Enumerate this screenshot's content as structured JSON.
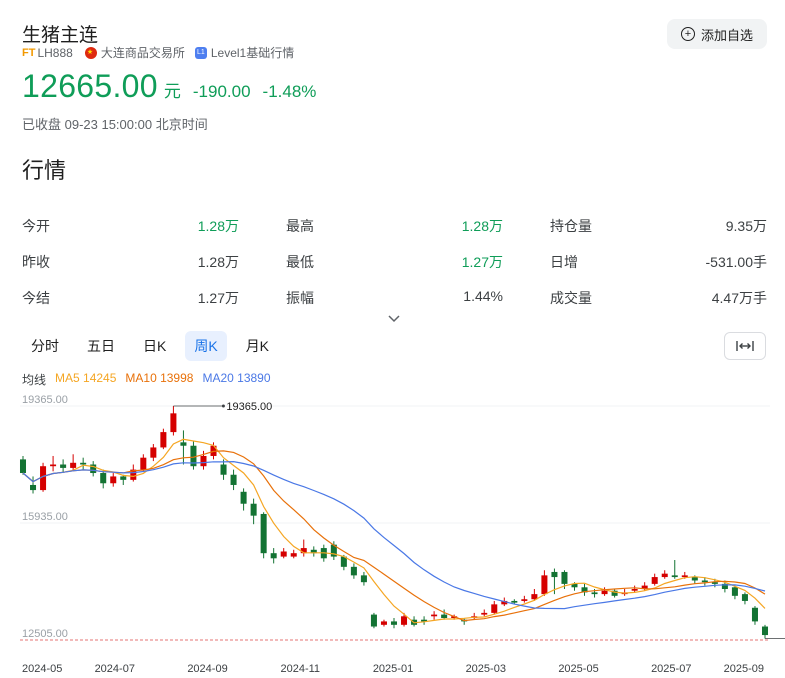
{
  "header": {
    "title": "生猪主连",
    "ft_badge": "FT",
    "code": "LH888",
    "exchange": "大连商品交易所",
    "level_badge": "L1",
    "level_text": "Level1基础行情",
    "add_button": "添加自选"
  },
  "quote": {
    "price": "12665.00",
    "unit": "元",
    "change": "-190.00",
    "change_pct": "-1.48%",
    "status": "已收盘 09-23 15:00:00 北京时间"
  },
  "section_title": "行情",
  "stats": [
    [
      {
        "label": "今开",
        "value": "1.28万",
        "color": "green"
      },
      {
        "label": "最高",
        "value": "1.28万",
        "color": "green"
      },
      {
        "label": "持仓量",
        "value": "9.35万",
        "color": "plain"
      }
    ],
    [
      {
        "label": "昨收",
        "value": "1.28万",
        "color": "plain"
      },
      {
        "label": "最低",
        "value": "1.27万",
        "color": "green"
      },
      {
        "label": "日增",
        "value": "-531.00手",
        "color": "plain"
      }
    ],
    [
      {
        "label": "今结",
        "value": "1.27万",
        "color": "plain"
      },
      {
        "label": "振幅",
        "value": "1.44%",
        "color": "plain"
      },
      {
        "label": "成交量",
        "value": "4.47万手",
        "color": "plain"
      }
    ]
  ],
  "tabs": [
    {
      "label": "分时",
      "active": false
    },
    {
      "label": "五日",
      "active": false
    },
    {
      "label": "日K",
      "active": false
    },
    {
      "label": "周K",
      "active": true
    },
    {
      "label": "月K",
      "active": false
    }
  ],
  "ma": {
    "label": "均线",
    "ma5": "MA5 14245",
    "ma10": "MA10 13998",
    "ma20": "MA20 13890"
  },
  "colors": {
    "up": "#d50000",
    "down": "#137333",
    "ma5": "#f5a623",
    "ma10": "#e8710a",
    "ma20": "#4a78e6",
    "green_text": "#0f9d58"
  },
  "chart_data": {
    "type": "candlestick",
    "y_labels": [
      "19365.00",
      "15935.00",
      "12505.00"
    ],
    "ylim": [
      12505,
      19365
    ],
    "x_labels": [
      "2024-05",
      "2024-07",
      "2024-09",
      "2024-11",
      "2025-01",
      "2025-03",
      "2025-05",
      "2025-07",
      "2025-09"
    ],
    "max_annotation": "19365.00",
    "min_annotation": "12505.00",
    "candles": [
      [
        17800,
        17400,
        17900,
        17350
      ],
      [
        17050,
        16900,
        17300,
        16800
      ],
      [
        16900,
        17600,
        17700,
        16850
      ],
      [
        17600,
        17650,
        17900,
        17450
      ],
      [
        17650,
        17550,
        17800,
        17400
      ],
      [
        17550,
        17700,
        17950,
        17450
      ],
      [
        17700,
        17650,
        17850,
        17500
      ],
      [
        17650,
        17400,
        17750,
        17300
      ],
      [
        17400,
        17100,
        17500,
        16950
      ],
      [
        17100,
        17300,
        17400,
        17000
      ],
      [
        17300,
        17200,
        17350,
        17050
      ],
      [
        17200,
        17500,
        17650,
        17150
      ],
      [
        17500,
        17850,
        17950,
        17450
      ],
      [
        17850,
        18150,
        18250,
        17750
      ],
      [
        18150,
        18600,
        18700,
        18100
      ],
      [
        18600,
        19150,
        19365,
        18500
      ],
      [
        18300,
        18200,
        18650,
        17650
      ],
      [
        18200,
        17600,
        18350,
        17500
      ],
      [
        17600,
        17900,
        18050,
        17500
      ],
      [
        17900,
        18200,
        18300,
        17800
      ],
      [
        17650,
        17350,
        17800,
        17200
      ],
      [
        17350,
        17050,
        17500,
        16900
      ],
      [
        16850,
        16500,
        16950,
        16300
      ],
      [
        16500,
        16150,
        16650,
        15900
      ],
      [
        16200,
        15050,
        16250,
        14900
      ],
      [
        15050,
        14900,
        15200,
        14750
      ],
      [
        14950,
        15100,
        15200,
        14900
      ],
      [
        14950,
        15050,
        15150,
        14900
      ],
      [
        15050,
        15200,
        15450,
        14950
      ],
      [
        15150,
        15050,
        15250,
        14950
      ],
      [
        15200,
        14900,
        15300,
        14800
      ],
      [
        15300,
        14950,
        15400,
        14850
      ],
      [
        14950,
        14650,
        15000,
        14550
      ],
      [
        14650,
        14400,
        14750,
        14300
      ],
      [
        14400,
        14200,
        14500,
        14100
      ],
      [
        13250,
        12900,
        13300,
        12850
      ],
      [
        12950,
        13050,
        13100,
        12900
      ],
      [
        13050,
        12950,
        13150,
        12850
      ],
      [
        12950,
        13200,
        13300,
        12900
      ],
      [
        13100,
        12950,
        13200,
        12900
      ],
      [
        13100,
        13050,
        13200,
        12950
      ],
      [
        13200,
        13250,
        13350,
        13100
      ],
      [
        13250,
        13150,
        13400,
        13100
      ],
      [
        13150,
        13200,
        13250,
        13100
      ],
      [
        13100,
        13050,
        13150,
        12950
      ],
      [
        13150,
        13200,
        13300,
        13100
      ],
      [
        13250,
        13300,
        13400,
        13200
      ],
      [
        13300,
        13550,
        13650,
        13250
      ],
      [
        13550,
        13650,
        13750,
        13500
      ],
      [
        13650,
        13600,
        13700,
        13550
      ],
      [
        13650,
        13700,
        13800,
        13600
      ],
      [
        13700,
        13850,
        14000,
        13650
      ],
      [
        13850,
        14400,
        14550,
        13800
      ],
      [
        14500,
        14350,
        14600,
        13850
      ],
      [
        14500,
        14150,
        14550,
        14000
      ],
      [
        14150,
        14050,
        14200,
        13950
      ],
      [
        14050,
        13900,
        14150,
        13800
      ],
      [
        13900,
        13850,
        14000,
        13750
      ],
      [
        13850,
        13950,
        14050,
        13800
      ],
      [
        13950,
        13800,
        14000,
        13750
      ],
      [
        13850,
        13900,
        14000,
        13800
      ],
      [
        13950,
        14000,
        14100,
        13900
      ],
      [
        14000,
        14100,
        14200,
        13950
      ],
      [
        14150,
        14350,
        14450,
        14100
      ],
      [
        14350,
        14450,
        14550,
        14300
      ],
      [
        14400,
        14350,
        14850,
        14300
      ],
      [
        14350,
        14400,
        14500,
        14300
      ],
      [
        14350,
        14250,
        14400,
        14150
      ],
      [
        14250,
        14200,
        14350,
        14100
      ],
      [
        14200,
        14150,
        14300,
        14050
      ],
      [
        14150,
        14000,
        14250,
        13900
      ],
      [
        14050,
        13800,
        14100,
        13700
      ],
      [
        13850,
        13650,
        13900,
        13550
      ],
      [
        13450,
        13050,
        13500,
        12950
      ],
      [
        12900,
        12650,
        12950,
        12550
      ]
    ]
  }
}
